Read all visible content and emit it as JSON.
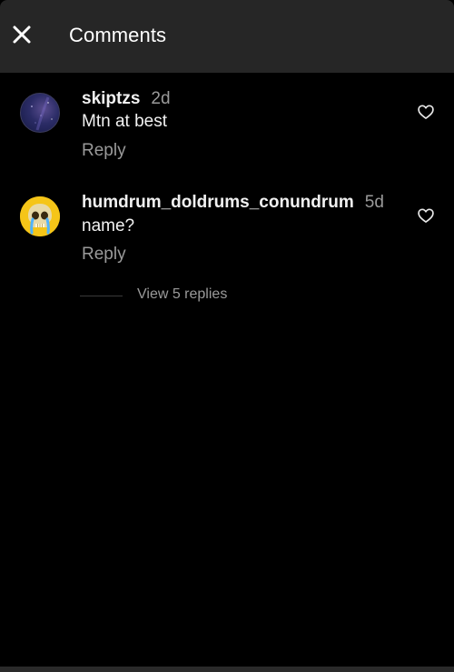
{
  "header": {
    "title": "Comments",
    "close_icon": "close-icon"
  },
  "comments": [
    {
      "username": "skiptzs",
      "time": "2d",
      "text": "Mtn at best",
      "reply_label": "Reply",
      "avatar": "night-sky-avatar"
    },
    {
      "username": "humdrum_doldrums_conundrum",
      "time": "5d",
      "text": "name?",
      "reply_label": "Reply",
      "avatar": "crying-skull-avatar",
      "view_replies_label": "View 5 replies"
    }
  ],
  "colors": {
    "header_bg": "#262626",
    "background": "#000000",
    "primary_text": "#f2f2f2",
    "secondary_text": "#9a9a9a",
    "avatar_yellow": "#f5c518"
  }
}
